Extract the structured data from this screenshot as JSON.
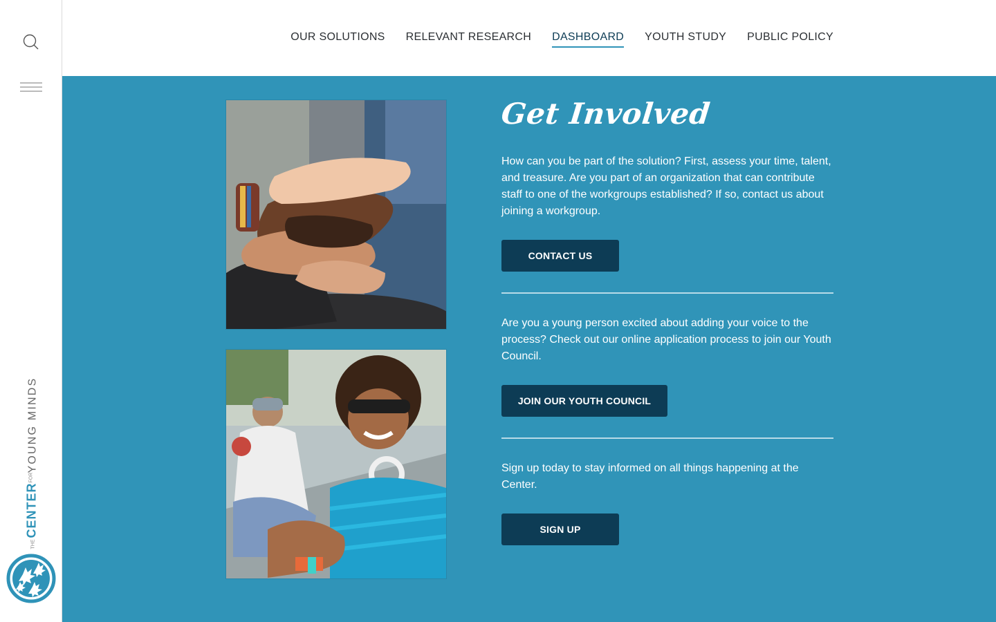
{
  "brand": {
    "the": "THE",
    "center": "CENTER",
    "for": "FOR",
    "young_minds": "YOUNG MINDS"
  },
  "nav": {
    "items": [
      {
        "label": "OUR SOLUTIONS"
      },
      {
        "label": "RELEVANT RESEARCH"
      },
      {
        "label": "DASHBOARD",
        "active": true
      },
      {
        "label": "YOUTH STUDY"
      },
      {
        "label": "PUBLIC POLICY"
      }
    ]
  },
  "icons": {
    "search": "search-icon",
    "menu": "hamburger-menu-icon",
    "logo": "leaves-logo-icon"
  },
  "colors": {
    "accent_blue": "#3094b8",
    "button_navy": "#0d3c55",
    "logo_blue": "#2f93b8"
  },
  "get_involved": {
    "headline": "Get Involved",
    "section1_text": "How can you be part of the solution? First, assess your time, talent, and treasure. Are you part of an organization that can contribute staff to one of the workgroups established? If so, contact us about joining a workgroup.",
    "contact_button": "CONTACT US",
    "section2_text": "Are you a young person excited about adding your voice to the process? Check out our online application process to join our Youth Council.",
    "youth_button": "JOIN OUR YOUTH COUNCIL",
    "section3_text": "Sign up today to stay informed on all things happening at the Center.",
    "signup_button": "SIGN UP"
  }
}
